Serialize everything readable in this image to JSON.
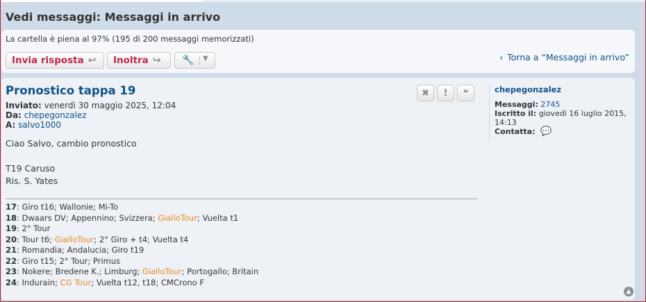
{
  "header": {
    "title": "Vedi messaggi: Messaggi in arrivo"
  },
  "toolbar": {
    "capacity": "La cartella è piena al 97% (195 di 200 messaggi memorizzati)",
    "reply_label": "Invia risposta",
    "forward_label": "Inoltra",
    "back_link": "Torna a “Messaggi in arrivo”"
  },
  "message": {
    "title": "Pronostico tappa 19",
    "sent_label": "Inviato:",
    "sent_value": "venerdì 30 maggio 2025, 12:04",
    "from_label": "Da:",
    "from_value": "chepegonzalez",
    "to_label": "A:",
    "to_value": "salvo1000",
    "body": [
      "Ciao Salvo, cambio pronostico",
      "T19 Caruso",
      "Ris. S. Yates"
    ]
  },
  "signature": [
    {
      "num": "17",
      "parts": [
        {
          "t": ": Giro t16; Wallonie; Mi-To"
        }
      ]
    },
    {
      "num": "18",
      "parts": [
        {
          "t": ": Dwaars DV; Appennino; Svizzera; "
        },
        {
          "t": "GialloTour",
          "hl": true
        },
        {
          "t": "; Vuelta t1"
        }
      ]
    },
    {
      "num": "19",
      "parts": [
        {
          "t": ": 2° Tour"
        }
      ]
    },
    {
      "num": "20",
      "parts": [
        {
          "t": ": Tour t6; "
        },
        {
          "t": "GialloTour",
          "hl": true
        },
        {
          "t": "; 2° Giro + t4; Vuelta t4"
        }
      ]
    },
    {
      "num": "21",
      "parts": [
        {
          "t": ": Romandia; Andalucia; Giro t19"
        }
      ]
    },
    {
      "num": "22",
      "parts": [
        {
          "t": ": Giro t15; 2° Tour; Primus"
        }
      ]
    },
    {
      "num": "23",
      "parts": [
        {
          "t": ": Nokere; Bredene K.; Limburg; "
        },
        {
          "t": "GialloTour",
          "hl": true
        },
        {
          "t": "; Portogallo; Britain"
        }
      ]
    },
    {
      "num": "24",
      "parts": [
        {
          "t": ": Indurain; "
        },
        {
          "t": "CG Tour",
          "hl": true
        },
        {
          "t": "; Vuelta t12, t18; CMCrono F"
        }
      ]
    }
  ],
  "profile": {
    "name": "chepegonzalez",
    "posts_label": "Messaggi:",
    "posts_value": "2745",
    "joined_label": "Iscritto il:",
    "joined_value": "giovedì 16 luglio 2015, 14:13",
    "contact_label": "Contatta:"
  },
  "icons": {
    "reply": "reply-arrow-icon",
    "forward": "forward-arrow-icon",
    "tools": "wrench-icon",
    "delete": "close-icon",
    "report": "exclamation-icon",
    "quote": "quote-icon",
    "contact": "speech-bubble-icon",
    "top": "chevron-up-circle-icon"
  },
  "colors": {
    "link": "#105289",
    "button_text": "#bc2a4d",
    "highlight": "#e8891d",
    "frame": "#c02020"
  }
}
